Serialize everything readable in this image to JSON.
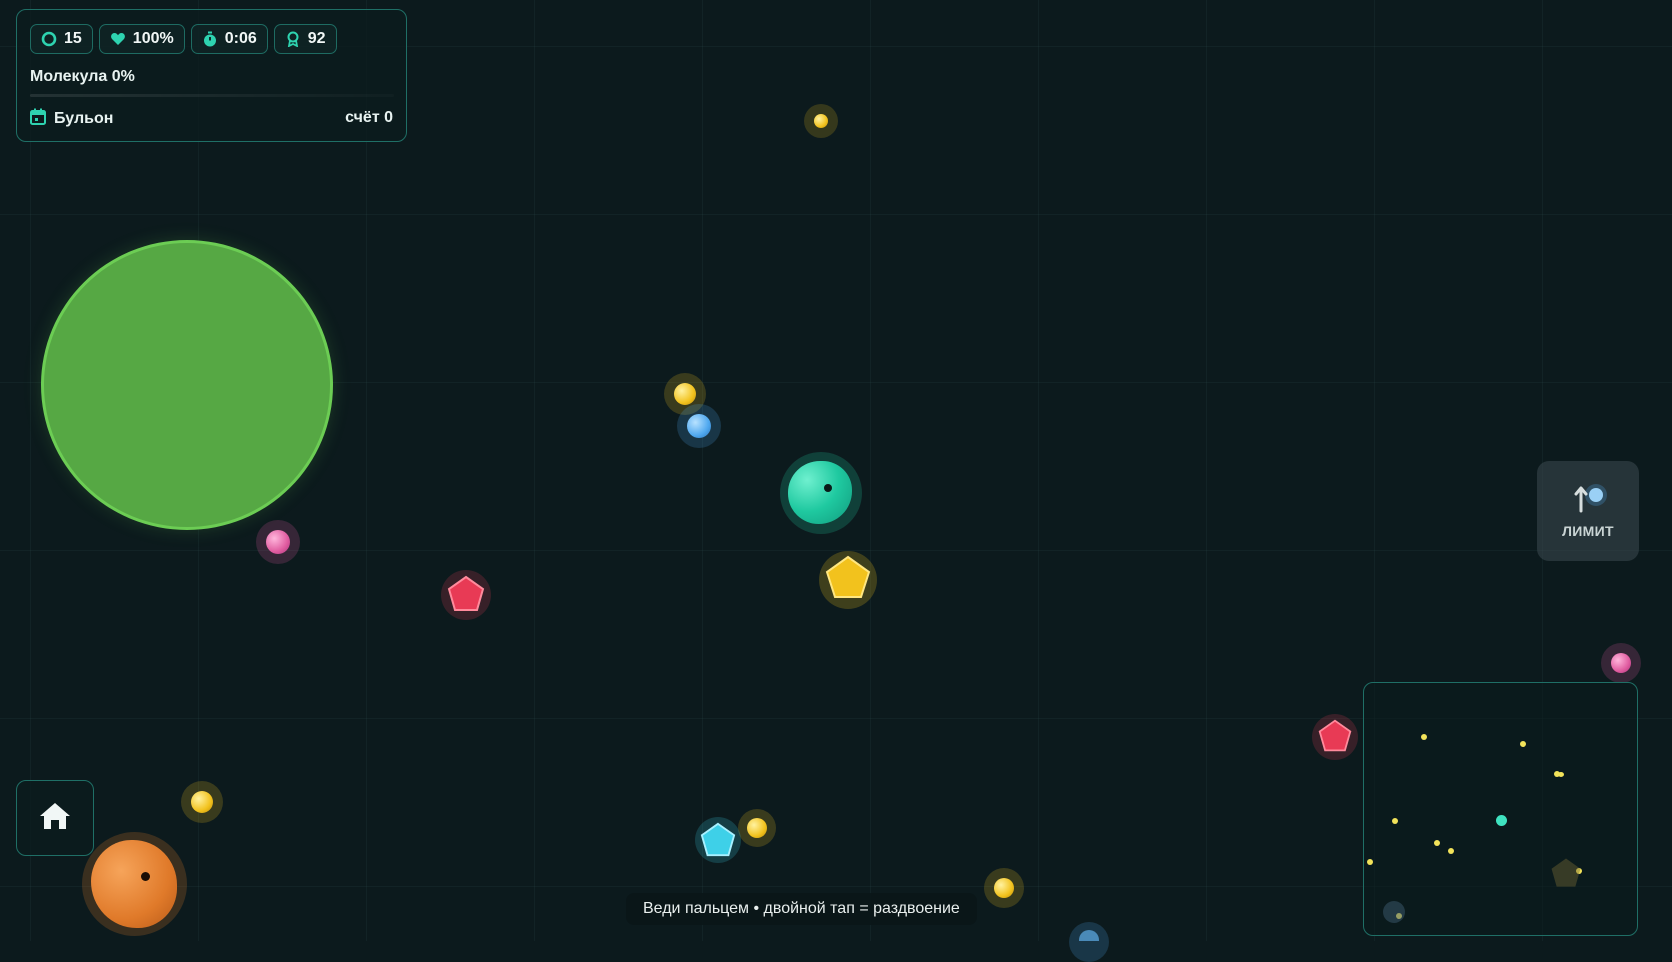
{
  "hud": {
    "stats": [
      {
        "icon": "ring-icon",
        "value": "15"
      },
      {
        "icon": "heart-icon",
        "value": "100%"
      },
      {
        "icon": "stopwatch-icon",
        "value": "0:06"
      },
      {
        "icon": "award-icon",
        "value": "92"
      }
    ],
    "molecule_label": "Молекула 0%",
    "molecule_progress": 0,
    "biome_label": "Бульон",
    "score_label": "счёт 0"
  },
  "limit_button": {
    "label": "ЛИМИТ"
  },
  "hint": "Веди пальцем • двойной тап = раздвоение",
  "colors": {
    "accent": "#2ed3b0",
    "panel_border": "#1f6f66",
    "background": "#0c1a1d",
    "player": "#1fc9a0",
    "big_cell": "#56a844",
    "enemy_orange": "#e07a2a",
    "pellet_yellow": "#f2c21d",
    "pellet_blue": "#4fa8ef",
    "pellet_pink": "#e05ca0",
    "pellet_red": "#e83a55",
    "pellet_cyan": "#3ed0e8"
  }
}
